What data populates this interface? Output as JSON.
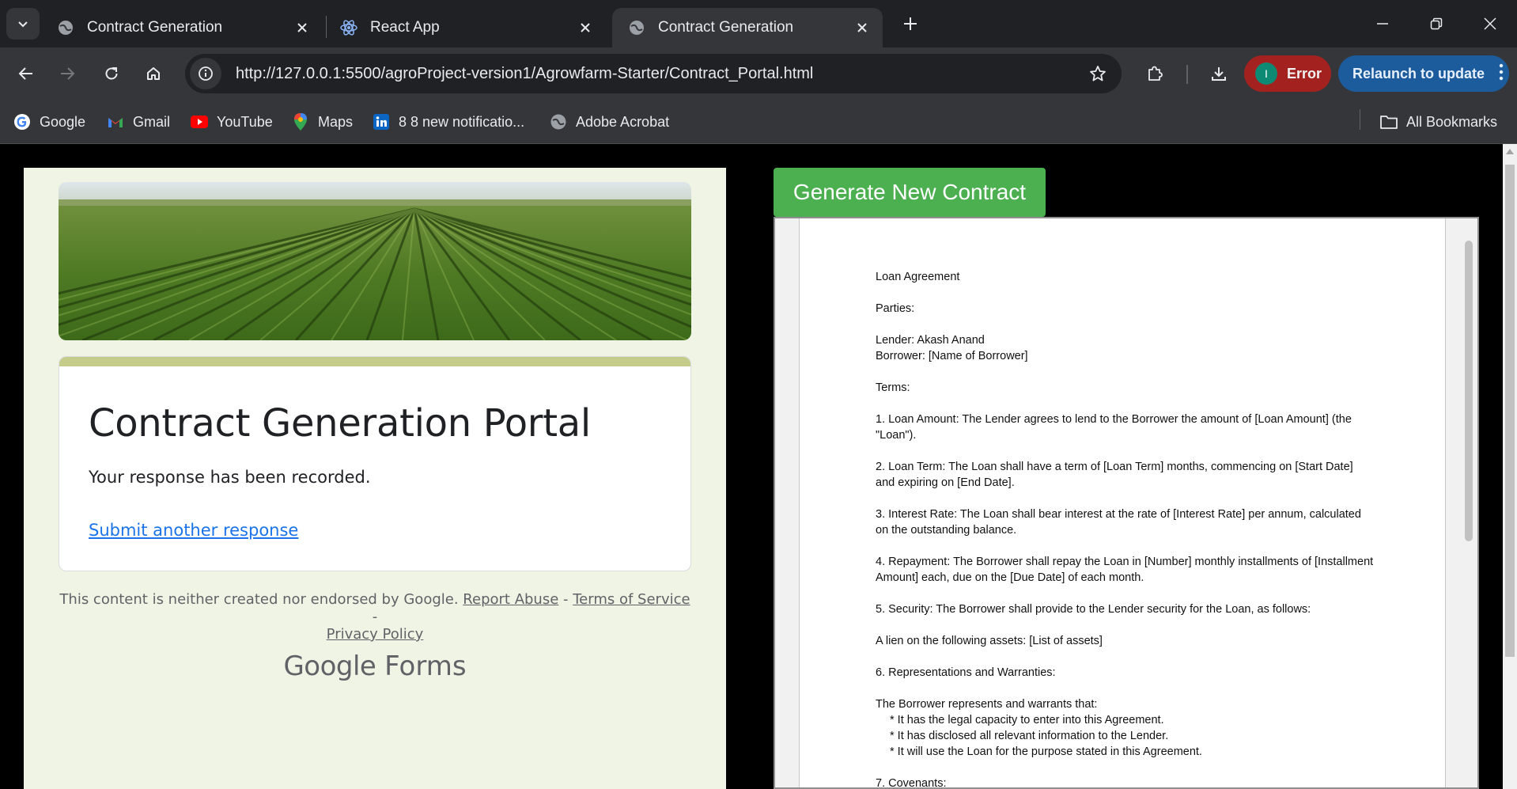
{
  "browser": {
    "tabs": [
      {
        "title": "Contract Generation",
        "icon": "globe-icon",
        "active": false
      },
      {
        "title": "React App",
        "icon": "react-icon",
        "active": false
      },
      {
        "title": "Contract Generation",
        "icon": "globe-icon",
        "active": true
      }
    ],
    "url": "http://127.0.0.1:5500/agroProject-version1/Agrowfarm-Starter/Contract_Portal.html",
    "profile_initial": "I",
    "error_label": "Error",
    "relaunch_label": "Relaunch to update",
    "bookmarks": [
      {
        "label": "Google",
        "icon": "google-icon"
      },
      {
        "label": "Gmail",
        "icon": "gmail-icon"
      },
      {
        "label": "YouTube",
        "icon": "youtube-icon"
      },
      {
        "label": "Maps",
        "icon": "maps-icon"
      },
      {
        "label": "8 8 new notificatio...",
        "icon": "linkedin-icon"
      },
      {
        "label": "Adobe Acrobat",
        "icon": "globe-icon"
      }
    ],
    "all_bookmarks_label": "All Bookmarks",
    "colors": {
      "error_pill": "#a32220",
      "relaunch_pill": "#1c5c9c",
      "avatar": "#0d8a74"
    }
  },
  "form": {
    "title": "Contract Generation Portal",
    "message": "Your response has been recorded.",
    "submit_another": "Submit another response",
    "disclaimer_text": "This content is neither created nor endorsed by Google.",
    "report_abuse": "Report Abuse",
    "terms": "Terms of Service",
    "privacy": "Privacy Policy",
    "sep1": " - ",
    "sep2": " - ",
    "brand_google": "Google",
    "brand_forms": "Forms",
    "colors": {
      "background": "#f0f4e4",
      "accent": "#c5cc8a",
      "link": "#1a73e8"
    }
  },
  "contract": {
    "generate_button": "Generate New Contract",
    "button_color": "#4caf50",
    "heading": "Loan Agreement",
    "parties_label": "Parties:",
    "lender": "Lender: Akash Anand",
    "borrower": "Borrower: [Name of Borrower]",
    "terms_label": "Terms:",
    "clause1": "1. Loan Amount: The Lender agrees to lend to the Borrower the amount of [Loan Amount] (the \"Loan\").",
    "clause2": "2. Loan Term: The Loan shall have a term of [Loan Term] months, commencing on [Start Date] and expiring on [End Date].",
    "clause3": "3. Interest Rate: The Loan shall bear interest at the rate of [Interest Rate] per annum, calculated on the outstanding balance.",
    "clause4": "4. Repayment: The Borrower shall repay the Loan in [Number] monthly installments of [Installment Amount] each, due on the [Due Date] of each month.",
    "clause5": "5. Security: The Borrower shall provide to the Lender security for the Loan, as follows:",
    "lien": "A lien on the following assets: [List of assets]",
    "clause6": "6. Representations and Warranties:",
    "warrant_intro": "The Borrower represents and warrants that:",
    "warrant1": "* It has the legal capacity to enter into this Agreement.",
    "warrant2": "* It has disclosed all relevant information to the Lender.",
    "warrant3": "* It will use the Loan for the purpose stated in this Agreement.",
    "clause7": "7. Covenants:"
  }
}
